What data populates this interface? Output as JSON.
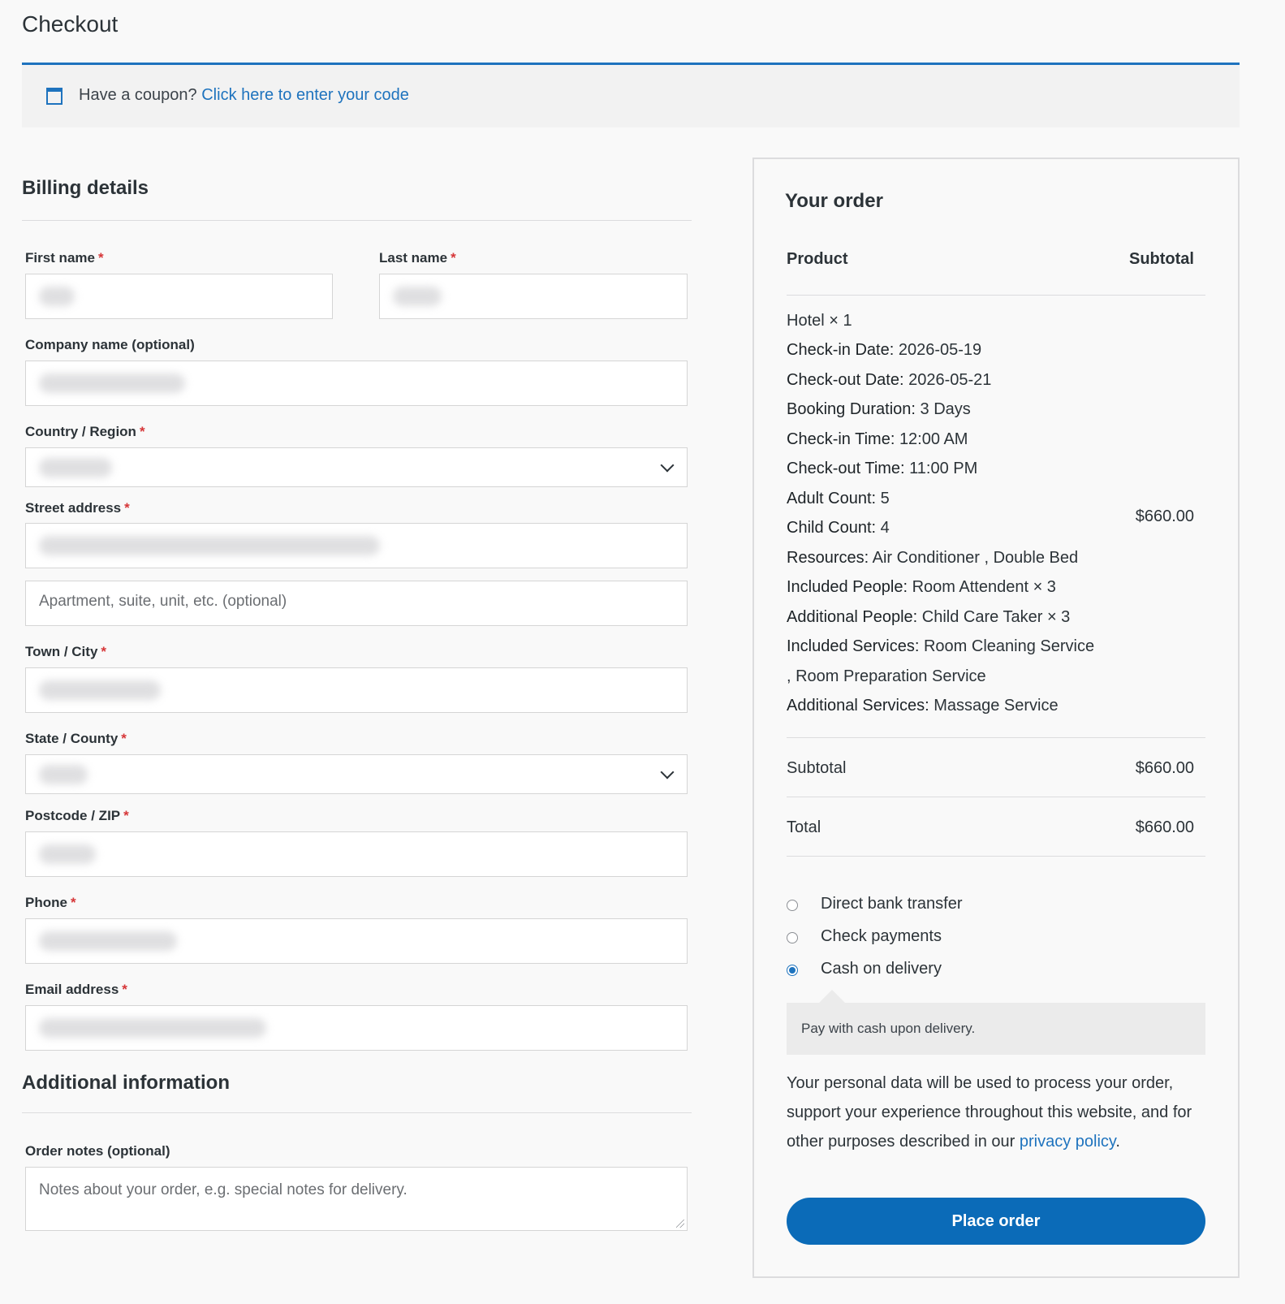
{
  "page": {
    "title": "Checkout"
  },
  "coupon": {
    "prompt": "Have a coupon?",
    "link": "Click here to enter your code"
  },
  "billing": {
    "title": "Billing details",
    "fields": {
      "first_name": {
        "label": "First name",
        "required": "*"
      },
      "last_name": {
        "label": "Last name",
        "required": "*"
      },
      "company": {
        "label": "Company name (optional)"
      },
      "country": {
        "label": "Country / Region",
        "required": "*"
      },
      "street": {
        "label": "Street address",
        "required": "*"
      },
      "apartment": {
        "placeholder": "Apartment, suite, unit, etc. (optional)"
      },
      "city": {
        "label": "Town / City",
        "required": "*"
      },
      "state": {
        "label": "State / County",
        "required": "*"
      },
      "postcode": {
        "label": "Postcode / ZIP",
        "required": "*"
      },
      "phone": {
        "label": "Phone",
        "required": "*"
      },
      "email": {
        "label": "Email address",
        "required": "*"
      }
    }
  },
  "additional": {
    "title": "Additional information",
    "notes_label": "Order notes (optional)",
    "notes_placeholder": "Notes about your order, e.g. special notes for delivery."
  },
  "order": {
    "title": "Your order",
    "col_product": "Product",
    "col_subtotal": "Subtotal",
    "item": {
      "name": "Hotel",
      "qty": "× 1",
      "meta": [
        {
          "k": "Check-in Date:",
          "v": "2026-05-19"
        },
        {
          "k": "Check-out Date:",
          "v": "2026-05-21"
        },
        {
          "k": "Booking Duration:",
          "v": "3 Days"
        },
        {
          "k": "Check-in Time:",
          "v": "12:00 AM"
        },
        {
          "k": "Check-out Time:",
          "v": "11:00 PM"
        },
        {
          "k": "Adult Count:",
          "v": "5"
        },
        {
          "k": "Child Count:",
          "v": "4"
        },
        {
          "k": "Resources:",
          "v": "Air Conditioner , Double Bed"
        },
        {
          "k": "Included People:",
          "v": "Room Attendent × 3"
        },
        {
          "k": "Additional People:",
          "v": "Child Care Taker × 3"
        },
        {
          "k": "Included Services:",
          "v": "Room Cleaning Service"
        },
        {
          "k": "",
          "v": ", Room Preparation Service"
        },
        {
          "k": "Additional Services:",
          "v": "Massage Service"
        }
      ],
      "price": "$660.00"
    },
    "subtotal_label": "Subtotal",
    "subtotal_value": "$660.00",
    "total_label": "Total",
    "total_value": "$660.00"
  },
  "payment": {
    "methods": [
      {
        "label": "Direct bank transfer",
        "selected": false
      },
      {
        "label": "Check payments",
        "selected": false
      },
      {
        "label": "Cash on delivery",
        "selected": true
      }
    ],
    "description": "Pay with cash upon delivery."
  },
  "privacy": {
    "text": "Your personal data will be used to process your order, support your experience throughout this website, and for other purposes described in our",
    "link": "privacy policy",
    "end": "."
  },
  "place_order": "Place order",
  "colors": {
    "accent": "#1e73be",
    "button": "#0b6bb8",
    "required": "#d63638"
  }
}
